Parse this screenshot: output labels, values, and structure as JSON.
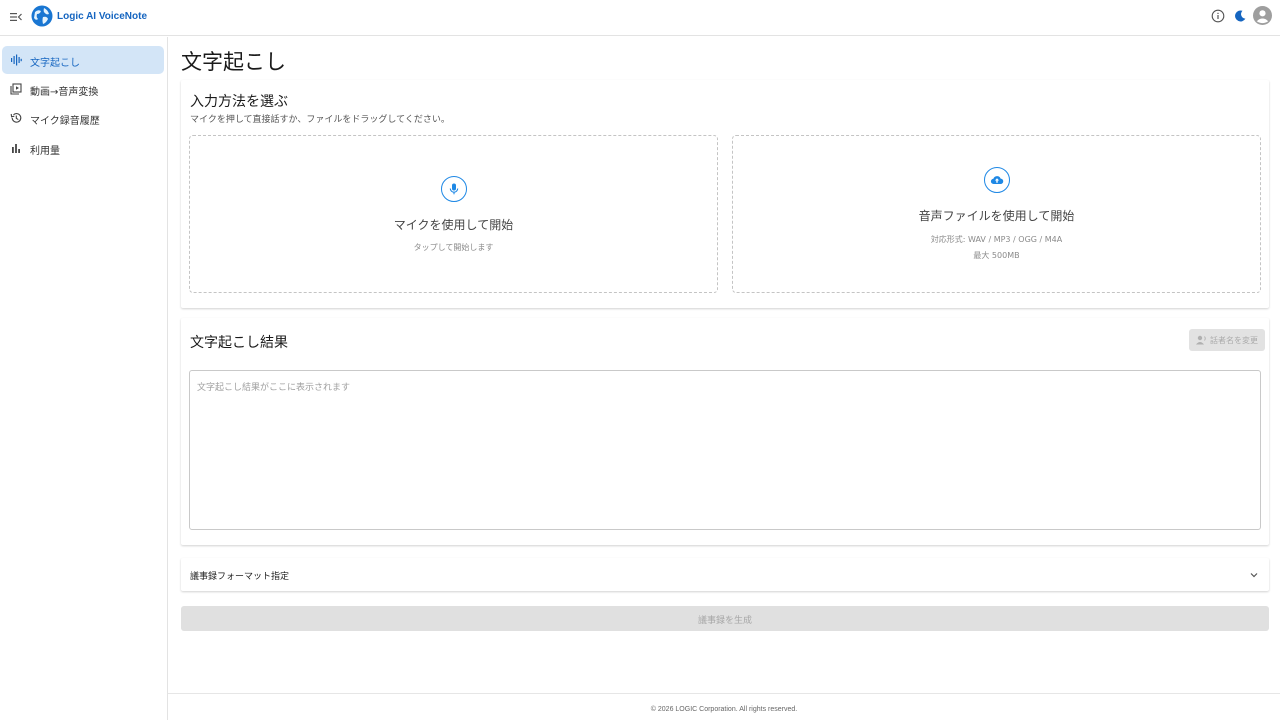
{
  "header": {
    "app_title": "Logic AI VoiceNote",
    "icons": [
      "menu-collapse-icon",
      "globe-logo",
      "info-icon",
      "moon-icon",
      "account-icon"
    ]
  },
  "sidebar": {
    "items": [
      {
        "label": "文字起こし",
        "icon": "waveform-icon",
        "active": true
      },
      {
        "label": "動画→音声変換",
        "icon": "video-library-icon",
        "active": false
      },
      {
        "label": "マイク録音履歴",
        "icon": "history-icon",
        "active": false
      },
      {
        "label": "利用量",
        "icon": "bar-chart-icon",
        "active": false
      }
    ]
  },
  "main": {
    "page_title": "文字起こし",
    "input_section": {
      "title": "入力方法を選ぶ",
      "subtitle": "マイクを押して直接話すか、ファイルをドラッグしてください。",
      "mic": {
        "label": "マイクを使用して開始",
        "hint": "タップして開始します"
      },
      "file": {
        "label": "音声ファイルを使用して開始",
        "formats": "対応形式: WAV / MP3 / OGG / M4A",
        "max_size": "最大 500MB"
      }
    },
    "result_section": {
      "title": "文字起こし結果",
      "rename_button": "話者名を変更",
      "placeholder": "文字起こし結果がここに表示されます",
      "value": ""
    },
    "format_section": {
      "label": "議事録フォーマット指定"
    },
    "generate_button": "議事録を生成"
  },
  "footer": {
    "text": "© 2026 LOGIC Corporation. All rights reserved."
  },
  "colors": {
    "accent": "#1e88e5",
    "brand": "#1565c0",
    "active_nav_bg": "#d3e5f7"
  }
}
